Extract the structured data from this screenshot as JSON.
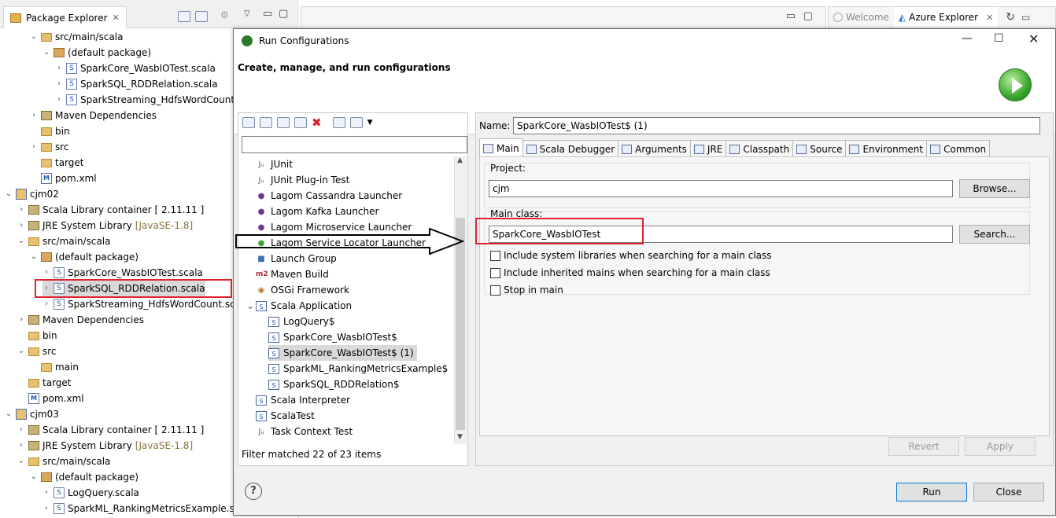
{
  "package_explorer": {
    "tab_label": "Package Explorer",
    "rows": [
      {
        "indent": 2,
        "twisty": "v",
        "icon": "folder",
        "label": "src/main/scala"
      },
      {
        "indent": 3,
        "twisty": "v",
        "icon": "pkg",
        "label": "(default package)"
      },
      {
        "indent": 4,
        "twisty": ">",
        "icon": "file",
        "label": "SparkCore_WasbIOTest.scala"
      },
      {
        "indent": 4,
        "twisty": ">",
        "icon": "file",
        "label": "SparkSQL_RDDRelation.scala"
      },
      {
        "indent": 4,
        "twisty": ">",
        "icon": "file",
        "label": "SparkStreaming_HdfsWordCount.sc"
      },
      {
        "indent": 2,
        "twisty": ">",
        "icon": "lib",
        "label": "Maven Dependencies"
      },
      {
        "indent": 2,
        "twisty": "",
        "icon": "folder",
        "label": "bin"
      },
      {
        "indent": 2,
        "twisty": ">",
        "icon": "folder",
        "label": "src"
      },
      {
        "indent": 2,
        "twisty": "",
        "icon": "folder",
        "label": "target"
      },
      {
        "indent": 2,
        "twisty": "",
        "icon": "xml",
        "label": "pom.xml"
      },
      {
        "indent": 0,
        "twisty": "v",
        "icon": "proj",
        "label": "cjm02"
      },
      {
        "indent": 1,
        "twisty": ">",
        "icon": "lib",
        "label": "Scala Library container [ 2.11.11 ]"
      },
      {
        "indent": 1,
        "twisty": ">",
        "icon": "lib",
        "label": "JRE System Library",
        "extra": "[JavaSE-1.8]"
      },
      {
        "indent": 1,
        "twisty": "v",
        "icon": "folder",
        "label": "src/main/scala"
      },
      {
        "indent": 2,
        "twisty": "v",
        "icon": "pkg",
        "label": "(default package)"
      },
      {
        "indent": 3,
        "twisty": ">",
        "icon": "file",
        "label": "SparkCore_WasbIOTest.scala"
      },
      {
        "indent": 3,
        "twisty": ">",
        "icon": "file",
        "label": "SparkSQL_RDDRelation.scala",
        "selected": true
      },
      {
        "indent": 3,
        "twisty": ">",
        "icon": "file",
        "label": "SparkStreaming_HdfsWordCount.sc"
      },
      {
        "indent": 1,
        "twisty": ">",
        "icon": "lib",
        "label": "Maven Dependencies"
      },
      {
        "indent": 1,
        "twisty": "",
        "icon": "folder",
        "label": "bin"
      },
      {
        "indent": 1,
        "twisty": "v",
        "icon": "folder",
        "label": "src"
      },
      {
        "indent": 2,
        "twisty": "",
        "icon": "folder",
        "label": "main"
      },
      {
        "indent": 1,
        "twisty": "",
        "icon": "folder",
        "label": "target"
      },
      {
        "indent": 1,
        "twisty": "",
        "icon": "xml",
        "label": "pom.xml"
      },
      {
        "indent": 0,
        "twisty": "v",
        "icon": "proj",
        "label": "cjm03"
      },
      {
        "indent": 1,
        "twisty": ">",
        "icon": "lib",
        "label": "Scala Library container [ 2.11.11 ]"
      },
      {
        "indent": 1,
        "twisty": ">",
        "icon": "lib",
        "label": "JRE System Library",
        "extra": "[JavaSE-1.8]"
      },
      {
        "indent": 1,
        "twisty": "v",
        "icon": "folder",
        "label": "src/main/scala"
      },
      {
        "indent": 2,
        "twisty": "v",
        "icon": "pkg",
        "label": "(default package)"
      },
      {
        "indent": 3,
        "twisty": ">",
        "icon": "file",
        "label": "LogQuery.scala"
      },
      {
        "indent": 3,
        "twisty": ">",
        "icon": "file",
        "label": "SparkML_RankingMetricsExample.s"
      }
    ]
  },
  "right_tabs": {
    "welcome": "Welcome",
    "azure": "Azure Explorer"
  },
  "dialog": {
    "title": "Run Configurations",
    "heading": "Create, manage, and run configurations",
    "filter_status": "Filter matched 22 of 23 items",
    "config_list": [
      {
        "indent": 0,
        "icon": "junit",
        "label": "JUnit"
      },
      {
        "indent": 0,
        "icon": "junit",
        "label": "JUnit Plug-in Test"
      },
      {
        "indent": 0,
        "icon": "lagom",
        "label": "Lagom Cassandra Launcher"
      },
      {
        "indent": 0,
        "icon": "lagom",
        "label": "Lagom Kafka Launcher"
      },
      {
        "indent": 0,
        "icon": "lagom",
        "label": "Lagom Microservice Launcher"
      },
      {
        "indent": 0,
        "icon": "lagom",
        "label": "Lagom Service Locator Launcher"
      },
      {
        "indent": 0,
        "icon": "group",
        "label": "Launch Group"
      },
      {
        "indent": 0,
        "icon": "m2",
        "label": "Maven Build"
      },
      {
        "indent": 0,
        "icon": "osgi",
        "label": "OSGi Framework"
      },
      {
        "indent": 0,
        "icon": "scala",
        "label": "Scala Application",
        "expanded": true
      },
      {
        "indent": 1,
        "icon": "scala",
        "label": "LogQuery$"
      },
      {
        "indent": 1,
        "icon": "scala",
        "label": "SparkCore_WasbIOTest$"
      },
      {
        "indent": 1,
        "icon": "scala",
        "label": "SparkCore_WasbIOTest$ (1)",
        "selected": true
      },
      {
        "indent": 1,
        "icon": "scala",
        "label": "SparkML_RankingMetricsExample$"
      },
      {
        "indent": 1,
        "icon": "scala",
        "label": "SparkSQL_RDDRelation$"
      },
      {
        "indent": 0,
        "icon": "scala",
        "label": "Scala Interpreter"
      },
      {
        "indent": 0,
        "icon": "scala",
        "label": "ScalaTest"
      },
      {
        "indent": 0,
        "icon": "junit",
        "label": "Task Context Test"
      }
    ],
    "name_label": "Name:",
    "name_value": "SparkCore_WasbIOTest$ (1)",
    "tabs": [
      "Main",
      "Scala Debugger",
      "Arguments",
      "JRE",
      "Classpath",
      "Source",
      "Environment",
      "Common"
    ],
    "project_label": "Project:",
    "project_value": "cjm",
    "browse_label": "Browse...",
    "main_class_label": "Main class:",
    "main_class_value": "SparkCore_WasbIOTest",
    "search_label": "Search...",
    "checkboxes": [
      "Include system libraries when searching for a main class",
      "Include inherited mains when searching for a main class",
      "Stop in main"
    ],
    "revert_label": "Revert",
    "apply_label": "Apply",
    "run_label": "Run",
    "close_label": "Close",
    "help_glyph": "?"
  },
  "colors": {
    "annotation_red": "#e0232f",
    "selection": "#d9d9d9",
    "default_button_border": "#0078d7"
  }
}
